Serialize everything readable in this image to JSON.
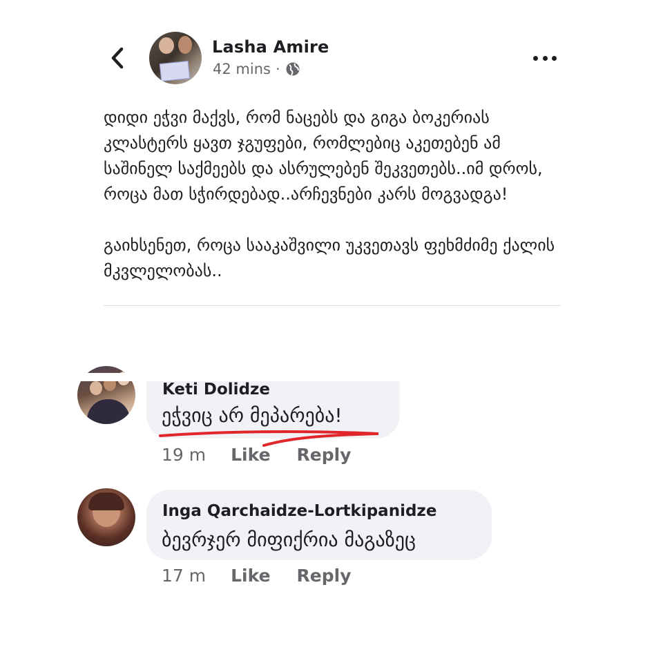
{
  "post": {
    "author": "Lasha Amire",
    "time": "42 mins",
    "separator": "·",
    "privacy_icon": "globe-icon",
    "back_icon": "chevron-left-icon",
    "more_icon": "more-horizontal-icon",
    "paragraphs": [
      "დიდი ეჭვი მაქვს, რომ ნაცებს და გიგა ბოკერიას კლასტერს ყავთ ჯგუფები, რომლებიც აკეთებენ ამ საშინელ საქმეებს და ასრულებენ შეკვეთებს..იმ დროს, როცა მათ სჭირდებად..არჩევნები კარს მოგვადგა!",
      "გაიხსენეთ, როცა სააკაშვილი უკვეთავს ფეხმძიმე ქალის მკვლელობას.."
    ]
  },
  "comments": [
    {
      "name": "Keti Dolidze",
      "text": "ეჭვიც არ მეპარება!",
      "time": "19 m",
      "like": "Like",
      "reply": "Reply",
      "underline_color": "#e0262a"
    },
    {
      "name": "Inga Qarchaidze-Lortkipanidze",
      "text": "ბევრჯერ მიფიქრია მაგაზეც",
      "time": "17 m",
      "like": "Like",
      "reply": "Reply"
    }
  ],
  "colors": {
    "text": "#1c1e21",
    "secondary": "#65676b",
    "bubble": "#f0f2f5",
    "divider": "#dadde1"
  }
}
